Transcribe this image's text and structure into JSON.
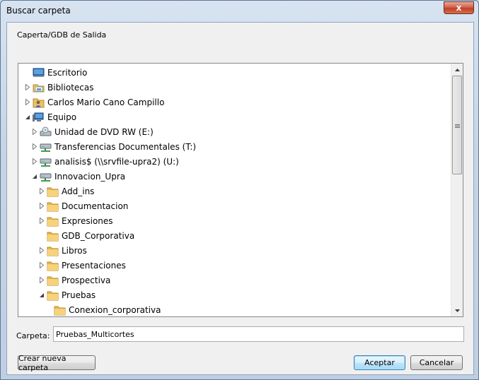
{
  "window": {
    "title": "Buscar carpeta",
    "close_glyph": "x"
  },
  "dialog": {
    "instruction": "Caperta/GDB de Salida",
    "folder_label": "Carpeta:",
    "folder_value": "Pruebas_Multicortes",
    "new_folder_button": "Crear nueva carpeta",
    "ok_button": "Aceptar",
    "cancel_button": "Cancelar"
  },
  "tree": {
    "items": [
      {
        "label": "Escritorio",
        "icon": "desktop-icon",
        "state": "none",
        "depth": 0
      },
      {
        "label": "Bibliotecas",
        "icon": "libraries-icon",
        "state": "collapsed",
        "depth": 0
      },
      {
        "label": "Carlos Mario Cano Campillo",
        "icon": "user-folder-icon",
        "state": "collapsed",
        "depth": 0
      },
      {
        "label": "Equipo",
        "icon": "computer-icon",
        "state": "expanded",
        "depth": 0
      },
      {
        "label": "Unidad de DVD RW (E:)",
        "icon": "dvd-drive-icon",
        "state": "collapsed",
        "depth": 1
      },
      {
        "label": "Transferencias Documentales (T:)",
        "icon": "network-drive-icon",
        "state": "collapsed",
        "depth": 1
      },
      {
        "label": "analisis$ (\\\\srvfile-upra2) (U:)",
        "icon": "network-drive-icon",
        "state": "collapsed",
        "depth": 1
      },
      {
        "label": "Innovacion_Upra",
        "icon": "network-drive-icon",
        "state": "expanded",
        "depth": 1
      },
      {
        "label": "Add_ins",
        "icon": "folder-icon",
        "state": "collapsed",
        "depth": 2
      },
      {
        "label": "Documentacion",
        "icon": "folder-icon",
        "state": "collapsed",
        "depth": 2
      },
      {
        "label": "Expresiones",
        "icon": "folder-icon",
        "state": "collapsed",
        "depth": 2
      },
      {
        "label": "GDB_Corporativa",
        "icon": "folder-icon",
        "state": "none",
        "depth": 2
      },
      {
        "label": "Libros",
        "icon": "folder-icon",
        "state": "collapsed",
        "depth": 2
      },
      {
        "label": "Presentaciones",
        "icon": "folder-icon",
        "state": "collapsed",
        "depth": 2
      },
      {
        "label": "Prospectiva",
        "icon": "folder-icon",
        "state": "collapsed",
        "depth": 2
      },
      {
        "label": "Pruebas",
        "icon": "folder-icon",
        "state": "expanded",
        "depth": 2
      },
      {
        "label": "Conexion_corporativa",
        "icon": "folder-icon",
        "state": "none",
        "depth": 3
      }
    ]
  }
}
